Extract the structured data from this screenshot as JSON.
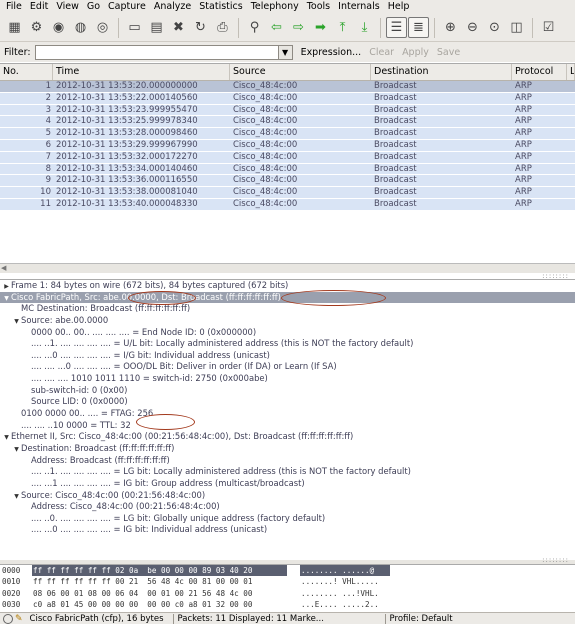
{
  "menu": [
    "File",
    "Edit",
    "View",
    "Go",
    "Capture",
    "Analyze",
    "Statistics",
    "Telephony",
    "Tools",
    "Internals",
    "Help"
  ],
  "toolbar": {
    "icons": [
      "interfaces-icon",
      "options-icon",
      "start-capture-icon",
      "stop-capture-icon",
      "restart-capture-icon",
      "open-file-icon",
      "save-file-icon",
      "close-file-icon",
      "reload-icon",
      "print-icon",
      "find-icon",
      "back-icon",
      "forward-icon",
      "goto-icon",
      "first-packet-icon",
      "last-packet-icon",
      "colorize-icon",
      "autoscroll-icon",
      "zoom-in-icon",
      "zoom-out-icon",
      "zoom-normal-icon",
      "resize-columns-icon",
      "capture-filters-icon"
    ]
  },
  "filter": {
    "label": "Filter:",
    "value": "",
    "expression": "Expression...",
    "clear": "Clear",
    "apply": "Apply",
    "save": "Save"
  },
  "packet_list": {
    "columns": [
      "No.",
      "Time",
      "Source",
      "Destination",
      "Protocol",
      "Le"
    ],
    "rows": [
      {
        "no": "1",
        "time": "2012-10-31  13:53:20.000000000",
        "src": "Cisco_48:4c:00",
        "dst": "Broadcast",
        "proto": "ARP"
      },
      {
        "no": "2",
        "time": "2012-10-31  13:53:22.000140560",
        "src": "Cisco_48:4c:00",
        "dst": "Broadcast",
        "proto": "ARP"
      },
      {
        "no": "3",
        "time": "2012-10-31  13:53:23.999955470",
        "src": "Cisco_48:4c:00",
        "dst": "Broadcast",
        "proto": "ARP"
      },
      {
        "no": "4",
        "time": "2012-10-31  13:53:25.999978340",
        "src": "Cisco_48:4c:00",
        "dst": "Broadcast",
        "proto": "ARP"
      },
      {
        "no": "5",
        "time": "2012-10-31  13:53:28.000098460",
        "src": "Cisco_48:4c:00",
        "dst": "Broadcast",
        "proto": "ARP"
      },
      {
        "no": "6",
        "time": "2012-10-31  13:53:29.999967990",
        "src": "Cisco_48:4c:00",
        "dst": "Broadcast",
        "proto": "ARP"
      },
      {
        "no": "7",
        "time": "2012-10-31  13:53:32.000172270",
        "src": "Cisco_48:4c:00",
        "dst": "Broadcast",
        "proto": "ARP"
      },
      {
        "no": "8",
        "time": "2012-10-31  13:53:34.000140460",
        "src": "Cisco_48:4c:00",
        "dst": "Broadcast",
        "proto": "ARP"
      },
      {
        "no": "9",
        "time": "2012-10-31  13:53:36.000116550",
        "src": "Cisco_48:4c:00",
        "dst": "Broadcast",
        "proto": "ARP"
      },
      {
        "no": "10",
        "time": "2012-10-31  13:53:38.000081040",
        "src": "Cisco_48:4c:00",
        "dst": "Broadcast",
        "proto": "ARP"
      },
      {
        "no": "11",
        "time": "2012-10-31  13:53:40.000048330",
        "src": "Cisco_48:4c:00",
        "dst": "Broadcast",
        "proto": "ARP"
      }
    ]
  },
  "details": {
    "lines": [
      {
        "t": "closed",
        "i": 0,
        "text": "Frame 1: 84 bytes on wire (672 bits), 84 bytes captured (672 bits)"
      },
      {
        "t": "open",
        "i": 0,
        "text": "Cisco FabricPath, Src: abe.00.0000, Dst: Broadcast (ff:ff:ff:ff:ff:ff)"
      },
      {
        "t": "",
        "i": 1,
        "text": "MC Destination: Broadcast (ff:ff:ff:ff:ff:ff)"
      },
      {
        "t": "open",
        "i": 1,
        "text": "Source: abe.00.0000"
      },
      {
        "t": "",
        "i": 2,
        "text": "0000 00.. 00.. .... .... .... = End Node ID: 0 (0x000000)"
      },
      {
        "t": "",
        "i": 2,
        "text": ".... ..1. .... .... .... .... = U/L bit: Locally administered address (this is NOT the factory default)"
      },
      {
        "t": "",
        "i": 2,
        "text": ".... ...0 .... .... .... .... = I/G bit: Individual address (unicast)"
      },
      {
        "t": "",
        "i": 2,
        "text": ".... .... ...0 .... .... .... = OOO/DL Bit: Deliver in order (If DA) or Learn (If SA)"
      },
      {
        "t": "",
        "i": 2,
        "text": ".... .... .... 1010 1011 1110 = switch-id: 2750 (0x000abe)"
      },
      {
        "t": "",
        "i": 2,
        "text": "sub-switch-id: 0 (0x00)"
      },
      {
        "t": "",
        "i": 2,
        "text": "Source LID: 0 (0x0000)"
      },
      {
        "t": "",
        "i": 1,
        "text": "0100 0000 00.. .... = FTAG: 256"
      },
      {
        "t": "",
        "i": 1,
        "text": ".... .... ..10 0000 = TTL: 32"
      },
      {
        "t": "open",
        "i": 0,
        "text": "Ethernet II, Src: Cisco_48:4c:00 (00:21:56:48:4c:00), Dst: Broadcast (ff:ff:ff:ff:ff:ff)"
      },
      {
        "t": "open",
        "i": 1,
        "text": "Destination: Broadcast (ff:ff:ff:ff:ff:ff)"
      },
      {
        "t": "",
        "i": 2,
        "text": "Address: Broadcast (ff:ff:ff:ff:ff:ff)"
      },
      {
        "t": "",
        "i": 2,
        "text": ".... ..1. .... .... .... .... = LG bit: Locally administered address (this is NOT the factory default)"
      },
      {
        "t": "",
        "i": 2,
        "text": ".... ...1 .... .... .... .... = IG bit: Group address (multicast/broadcast)"
      },
      {
        "t": "open",
        "i": 1,
        "text": "Source: Cisco_48:4c:00 (00:21:56:48:4c:00)"
      },
      {
        "t": "",
        "i": 2,
        "text": "Address: Cisco_48:4c:00 (00:21:56:48:4c:00)"
      },
      {
        "t": "",
        "i": 2,
        "text": ".... ..0. .... .... .... .... = LG bit: Globally unique address (factory default)"
      },
      {
        "t": "",
        "i": 2,
        "text": ".... ...0 .... .... .... .... = IG bit: Individual address (unicast)"
      }
    ]
  },
  "bytes": [
    {
      "off": "0000",
      "hex": "ff ff ff ff ff ff 02 0a  be 00 00 00 89 03 40 20",
      "asc": "........ ......@ "
    },
    {
      "off": "0010",
      "hex": "ff ff ff ff ff ff 00 21  56 48 4c 00 81 00 00 01",
      "asc": ".......! VHL....."
    },
    {
      "off": "0020",
      "hex": "08 06 00 01 08 00 06 04  00 01 00 21 56 48 4c 00",
      "asc": "........ ...!VHL."
    },
    {
      "off": "0030",
      "hex": "c0 a8 01 45 00 00 00 00  00 00 c0 a8 01 32 00 00",
      "asc": "...E.... .....2.."
    }
  ],
  "status": {
    "file": "Cisco FabricPath (cfp), 16 bytes",
    "packets": "Packets: 11 Displayed: 11 Marke...",
    "profile": "Profile: Default"
  }
}
